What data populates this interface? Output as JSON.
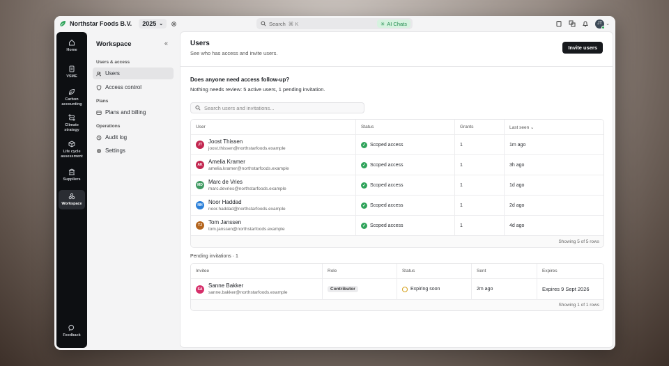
{
  "org": {
    "name": "Northstar Foods B.V.",
    "year": "2025"
  },
  "search": {
    "placeholder": "Search",
    "shortcut": "⌘ K",
    "ai_label": "AI Chats"
  },
  "user_avatar": "JT",
  "rail": [
    {
      "label": "Home",
      "icon": "home-icon"
    },
    {
      "label": "VSME",
      "icon": "document-icon"
    },
    {
      "label": "Carbon accounting",
      "icon": "leaf-icon"
    },
    {
      "label": "Climate strategy",
      "icon": "route-icon"
    },
    {
      "label": "Life cycle assessment",
      "icon": "cube-icon"
    },
    {
      "label": "Suppliers",
      "icon": "building-icon"
    },
    {
      "label": "Workspace",
      "icon": "workspace-icon"
    },
    {
      "label": "Feedback",
      "icon": "chat-icon"
    }
  ],
  "sidebar": {
    "title": "Workspace",
    "groups": [
      {
        "label": "Users & access",
        "items": [
          {
            "label": "Users",
            "icon": "users-icon"
          },
          {
            "label": "Access control",
            "icon": "shield-icon"
          }
        ]
      },
      {
        "label": "Plans",
        "items": [
          {
            "label": "Plans and billing",
            "icon": "card-icon"
          }
        ]
      },
      {
        "label": "Operations",
        "items": [
          {
            "label": "Audit log",
            "icon": "history-icon"
          },
          {
            "label": "Settings",
            "icon": "gear-icon"
          }
        ]
      }
    ]
  },
  "page": {
    "title": "Users",
    "subtitle": "See who has access and invite users.",
    "invite_label": "Invite users",
    "question": "Does anyone need access follow-up?",
    "summary": "Nothing needs review: 5 active users, 1 pending invitation.",
    "filter_placeholder": "Search users and invitations..."
  },
  "users_table": {
    "headers": [
      "User",
      "Status",
      "Grants",
      "Last seen ⌄"
    ],
    "rows": [
      {
        "initials": "JT",
        "name": "Joost Thissen",
        "email": "joost.thissen@northstarfoods.example",
        "status": "Scoped access",
        "grants": "1",
        "last_seen": "1m ago",
        "color": "#c2264f"
      },
      {
        "initials": "AK",
        "name": "Amelia Kramer",
        "email": "amelia.kramer@northstarfoods.example",
        "status": "Scoped access",
        "grants": "1",
        "last_seen": "3h ago",
        "color": "#c2264f"
      },
      {
        "initials": "MD",
        "name": "Marc de Vries",
        "email": "marc.devries@northstarfoods.example",
        "status": "Scoped access",
        "grants": "1",
        "last_seen": "1d ago",
        "color": "#3f9a62"
      },
      {
        "initials": "NH",
        "name": "Noor Haddad",
        "email": "noor.haddad@northstarfoods.example",
        "status": "Scoped access",
        "grants": "1",
        "last_seen": "2d ago",
        "color": "#2a7fd9"
      },
      {
        "initials": "TJ",
        "name": "Tom Janssen",
        "email": "tom.janssen@northstarfoods.example",
        "status": "Scoped access",
        "grants": "1",
        "last_seen": "4d ago",
        "color": "#b5651d"
      }
    ],
    "footer": "Showing 5 of 5 rows"
  },
  "pending": {
    "heading": "Pending invitations · 1",
    "headers": [
      "Invitee",
      "Role",
      "Status",
      "Sent",
      "Expires"
    ],
    "rows": [
      {
        "initials": "SA",
        "name": "Sanne Bakker",
        "email": "sanne.bakker@northstarfoods.example",
        "role": "Contributor",
        "status": "Expiring soon",
        "sent": "2m ago",
        "expires": "Expires 9 Sept 2026",
        "color": "#d62f6a"
      }
    ],
    "footer": "Showing 1 of 1 rows"
  }
}
